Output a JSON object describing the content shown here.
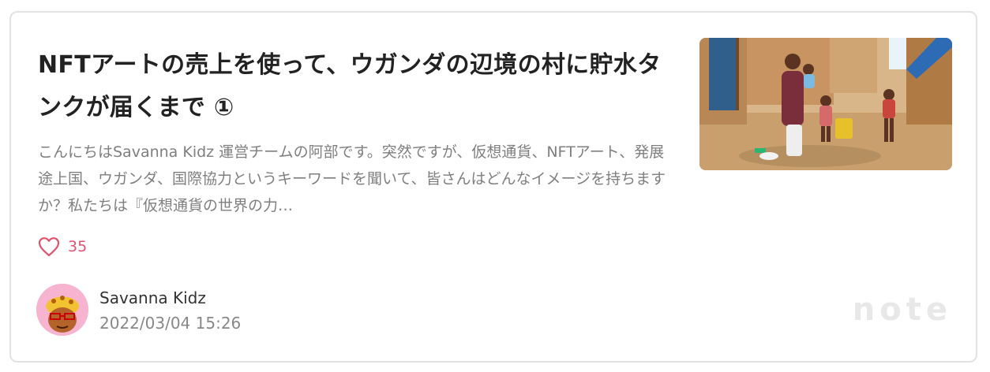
{
  "article": {
    "title": "NFTアートの売上を使って、ウガンダの辺境の村に貯水タンクが届くまで ①",
    "excerpt": "こんにちはSavanna Kidz 運営チームの阿部です。突然ですが、仮想通貨、NFTアート、発展途上国、ウガンダ、国際協力というキーワードを聞いて、皆さんはどんなイメージを持ちますか？私たちは『仮想通貨の世界の力…",
    "like_count": "35",
    "thumbnail_alt": "ウガンダの村の写真"
  },
  "author": {
    "name": "Savanna Kidz",
    "date": "2022/03/04 15:26"
  },
  "brand": {
    "label": "note"
  },
  "colors": {
    "like_accent": "#e0536f",
    "border": "#e2e2e2",
    "muted_text": "#7f7f7f"
  },
  "icons": {
    "like": "heart-outline-icon"
  }
}
